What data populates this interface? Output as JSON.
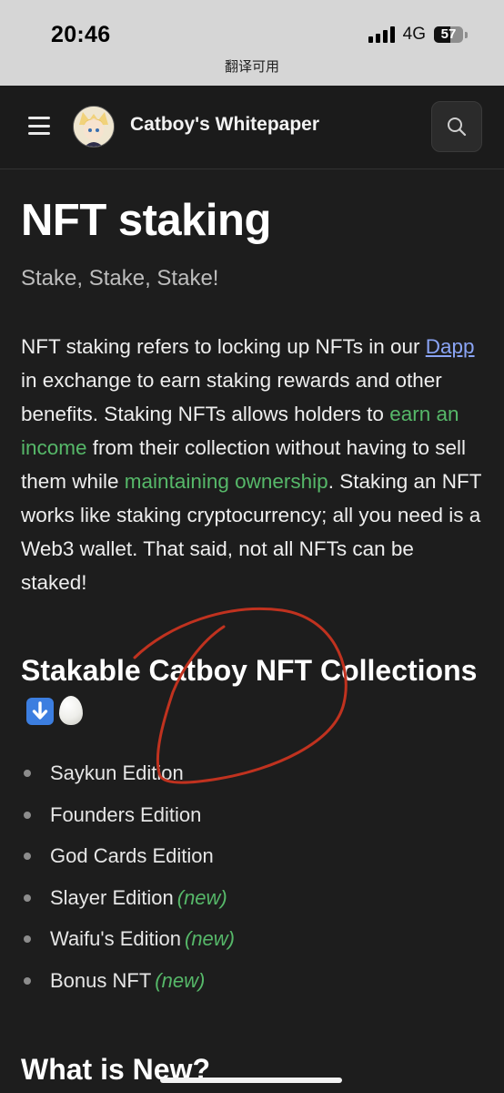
{
  "status_bar": {
    "time": "20:46",
    "network": "4G",
    "battery": "57",
    "battery_level": 0.57,
    "translate_notice": "翻译可用"
  },
  "header": {
    "site_title": "Catboy's Whitepaper",
    "menu_icon": "hamburger-menu-icon",
    "search_icon": "search-icon"
  },
  "page": {
    "title": "NFT staking",
    "subtitle": "Stake, Stake, Stake!",
    "intro": {
      "t1": "NFT staking refers to locking up NFTs in our ",
      "link_dapp": "Dapp",
      "t2": " in exchange to earn staking rewards and other benefits. Staking NFTs allows holders to ",
      "hl_income": "earn an income",
      "t3": " from their collection without having to sell them while ",
      "hl_ownership": "maintaining ownership",
      "t4": ". Staking an NFT works like staking cryptocurrency; all you need is a Web3 wallet. That said, not all NFTs can be staked!"
    },
    "section_heading": "Stakable Catboy NFT Collections",
    "section_emojis": [
      "down-arrow-emoji",
      "egg-emoji"
    ],
    "collections": [
      {
        "name": "Saykun Edition",
        "tag": ""
      },
      {
        "name": "Founders Edition",
        "tag": ""
      },
      {
        "name": "God Cards Edition",
        "tag": ""
      },
      {
        "name": "Slayer Edition",
        "tag": "(new)"
      },
      {
        "name": "Waifu's Edition",
        "tag": "(new)"
      },
      {
        "name": "Bonus NFT",
        "tag": "(new)"
      }
    ],
    "next_heading": "What is New?"
  },
  "colors": {
    "background": "#1d1d1d",
    "link": "#8aa4f4",
    "highlight_green": "#56b869",
    "annotation_red": "#c0321f",
    "status_bar_bg": "#d6d6d6"
  }
}
